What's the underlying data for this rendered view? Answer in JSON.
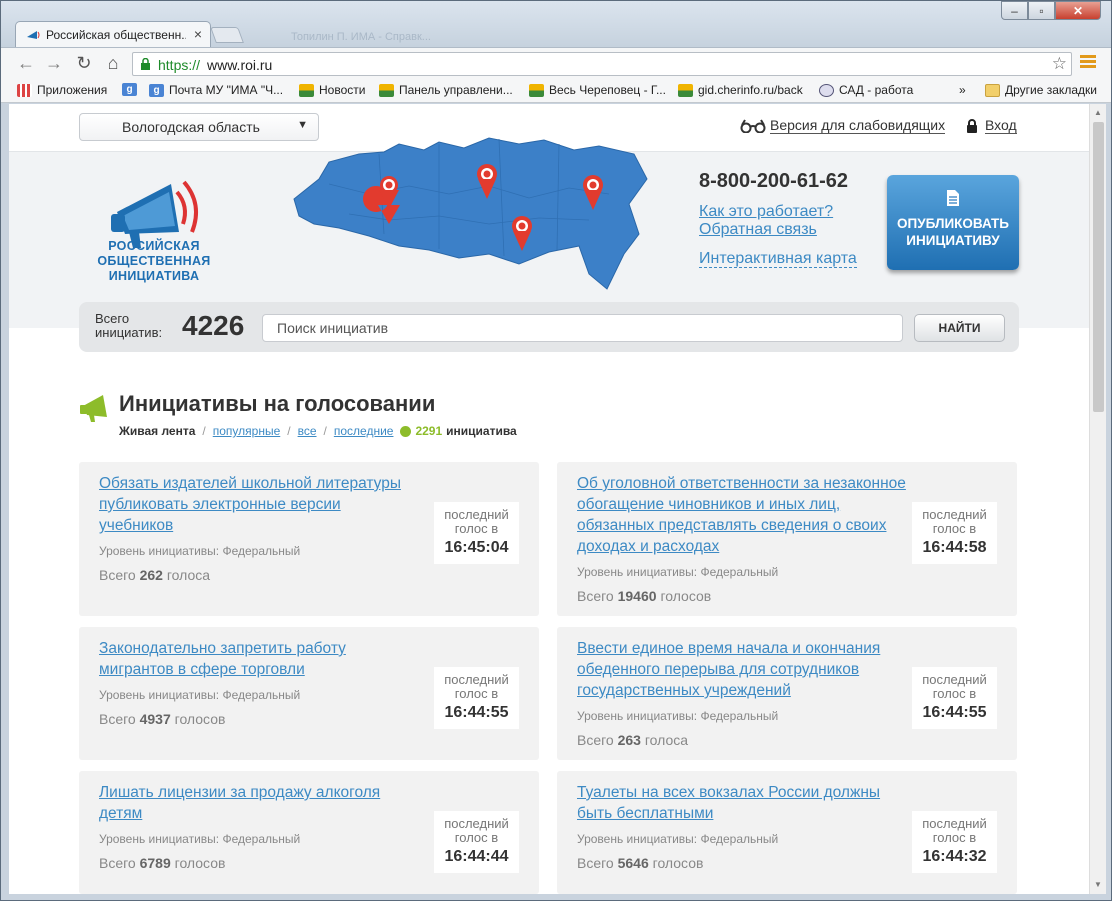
{
  "browser": {
    "tab_title": "Российская общественн...",
    "tab_ghost": "Топилин П. ИМА - Справк...",
    "url_scheme": "https://",
    "url_rest": "www.roi.ru",
    "bookmarks": [
      {
        "label": "Приложения",
        "icon": "apps-icon"
      },
      {
        "label": "",
        "icon": "google-icon"
      },
      {
        "label": "Почта МУ \"ИМА \"Ч...",
        "icon": "google-icon"
      },
      {
        "label": "Новости",
        "icon": "flag-icon"
      },
      {
        "label": "Панель управлени...",
        "icon": "flag-icon"
      },
      {
        "label": "Весь Череповец - Г...",
        "icon": "flag-icon"
      },
      {
        "label": "gid.cherinfo.ru/back",
        "icon": "flag-icon"
      },
      {
        "label": "САД - работа",
        "icon": "globe-icon"
      },
      {
        "label": "Другие закладки",
        "icon": "folder-icon"
      }
    ],
    "overflow": "»"
  },
  "header": {
    "region": "Вологодская область",
    "accessibility_link": "Версия для слабовидящих",
    "login_link": "Вход",
    "logo_lines": [
      "РОССИЙСКАЯ",
      "ОБЩЕСТВЕННАЯ",
      "ИНИЦИАТИВА"
    ],
    "phone": "8-800-200-61-62",
    "how_it_works": "Как это работает?",
    "feedback": "Обратная связь",
    "interactive_map": "Интерактивная карта",
    "publish_line1": "ОПУБЛИКОВАТЬ",
    "publish_line2": "ИНИЦИАТИВУ"
  },
  "search": {
    "total_label_1": "Всего",
    "total_label_2": "инициатив:",
    "total_count": "4226",
    "placeholder": "Поиск инициатив",
    "button": "НАЙТИ"
  },
  "section": {
    "title": "Инициативы на голосовании",
    "filter_active": "Живая лента",
    "filter_popular": "популярные",
    "filter_all": "все",
    "filter_latest": "последние",
    "count": "2291",
    "count_label": "инициатива"
  },
  "cards": [
    {
      "title": "Обязать издателей школьной литературы публиковать электронные версии учебников",
      "level": "Уровень инициативы: Федеральный",
      "votes_prefix": "Всего",
      "votes": "262",
      "votes_suffix": "голоса",
      "last_1": "последний",
      "last_2": "голос в",
      "time": "16:45:04"
    },
    {
      "title": "Об уголовной ответственности за незаконное обогащение чиновников и иных лиц, обязанных представлять сведения о своих доходах и расходах",
      "level": "Уровень инициативы: Федеральный",
      "votes_prefix": "Всего",
      "votes": "19460",
      "votes_suffix": "голосов",
      "last_1": "последний",
      "last_2": "голос в",
      "time": "16:44:58"
    },
    {
      "title": "Законодательно запретить работу мигрантов в сфере торговли",
      "level": "Уровень инициативы: Федеральный",
      "votes_prefix": "Всего",
      "votes": "4937",
      "votes_suffix": "голосов",
      "last_1": "последний",
      "last_2": "голос в",
      "time": "16:44:55"
    },
    {
      "title": "Ввести единое время начала и окончания обеденного перерыва для сотрудников государственных учреждений",
      "level": "Уровень инициативы: Федеральный",
      "votes_prefix": "Всего",
      "votes": "263",
      "votes_suffix": "голоса",
      "last_1": "последний",
      "last_2": "голос в",
      "time": "16:44:55"
    },
    {
      "title": "Лишать лицензии за продажу алкоголя детям",
      "level": "Уровень инициативы: Федеральный",
      "votes_prefix": "Всего",
      "votes": "6789",
      "votes_suffix": "голосов",
      "last_1": "последний",
      "last_2": "голос в",
      "time": "16:44:44"
    },
    {
      "title": "Туалеты на всех вокзалах России должны быть бесплатными",
      "level": "Уровень инициативы: Федеральный",
      "votes_prefix": "Всего",
      "votes": "5646",
      "votes_suffix": "голосов",
      "last_1": "последний",
      "last_2": "голос в",
      "time": "16:44:32"
    }
  ],
  "colors": {
    "link": "#3d8ac4",
    "brand_blue": "#1f6fb2",
    "accent_green": "#8dbc2a",
    "card_bg": "#f2f2f2"
  }
}
